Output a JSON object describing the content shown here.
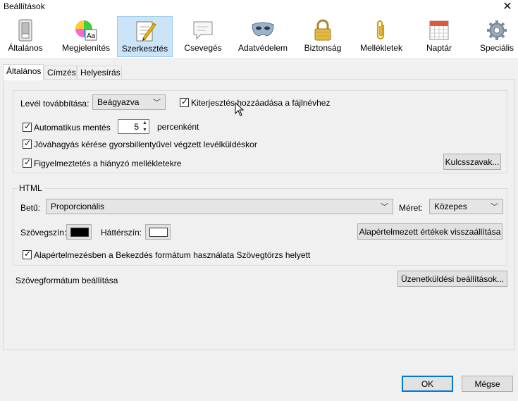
{
  "window": {
    "title": "Beállítások",
    "close_glyph": "✕"
  },
  "toolbar": {
    "items": [
      {
        "label": "Általános",
        "icon": "switch-icon"
      },
      {
        "label": "Megjelenítés",
        "icon": "palette-icon"
      },
      {
        "label": "Szerkesztés",
        "icon": "pencil-paper-icon",
        "selected": true
      },
      {
        "label": "Csevegés",
        "icon": "chat-bubble-icon"
      },
      {
        "label": "Adatvédelem",
        "icon": "mask-icon"
      },
      {
        "label": "Biztonság",
        "icon": "padlock-icon"
      },
      {
        "label": "Mellékletek",
        "icon": "paperclip-icon"
      },
      {
        "label": "Naptár",
        "icon": "calendar-icon"
      },
      {
        "label": "Speciális",
        "icon": "gear-icon"
      }
    ]
  },
  "tabs": [
    {
      "label": "Általános",
      "active": true
    },
    {
      "label": "Címzés"
    },
    {
      "label": "Helyesírás"
    }
  ],
  "general_group": {
    "forward_label": "Levél továbbítása:",
    "forward_value": "Beágyazva",
    "add_extension_label": "Kiterjesztés hozzáadása a fájlnévhez",
    "add_extension_checked": true,
    "autosave_label": "Automatikus mentés",
    "autosave_checked": true,
    "autosave_value": "5",
    "autosave_unit": "percenként",
    "confirm_shortcut_label": "Jóváhagyás kérése gyorsbillentyűvel végzett levélküldéskor",
    "confirm_shortcut_checked": true,
    "missing_attachment_label": "Figyelmeztetés a hiányzó mellékletekre",
    "missing_attachment_checked": true,
    "keywords_button": "Kulcsszavak..."
  },
  "html_group": {
    "title": "HTML",
    "font_label": "Betű:",
    "font_value": "Proporcionális",
    "size_label": "Méret:",
    "size_value": "Közepes",
    "text_color_label": "Szövegszín:",
    "text_color": "#000000",
    "bg_color_label": "Háttérszín:",
    "bg_color": "#ffffff",
    "restore_defaults_button": "Alapértelmezett értékek visszaállítása",
    "paragraph_label": "Alapértelmezésben a Bekezdés formátum használata Szövegtörzs helyett",
    "paragraph_checked": true
  },
  "text_format": {
    "label": "Szövegformátum beállítása",
    "button": "Üzenetküldési beállítások..."
  },
  "footer": {
    "ok": "OK",
    "cancel": "Mégse"
  },
  "colors": {
    "accent": "#0078d7",
    "selected_bg": "#cce4f7"
  }
}
